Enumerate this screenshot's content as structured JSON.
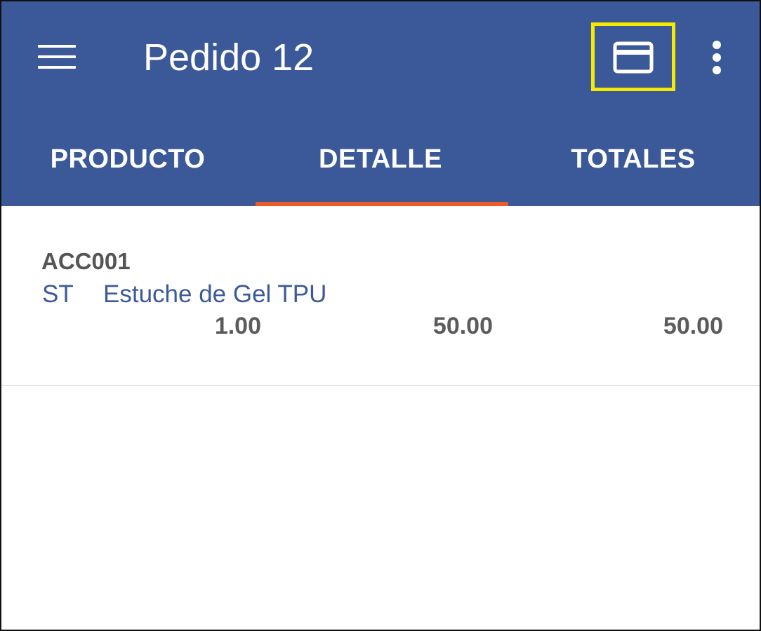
{
  "appbar": {
    "title": "Pedido 12",
    "menu_icon": "hamburger-menu-icon",
    "card_icon": "credit-card-icon",
    "more_icon": "more-vert-icon",
    "highlight_color": "#f5ea00",
    "background_color": "#3b5998"
  },
  "tabs": [
    {
      "label": "PRODUCTO",
      "active": false
    },
    {
      "label": "DETALLE",
      "active": true
    },
    {
      "label": "TOTALES",
      "active": false
    }
  ],
  "tab_indicator_color": "#f05a28",
  "items": [
    {
      "code": "ACC001",
      "unit": "ST",
      "description": "Estuche de Gel TPU",
      "quantity": "1.00",
      "price": "50.00",
      "total": "50.00"
    }
  ]
}
